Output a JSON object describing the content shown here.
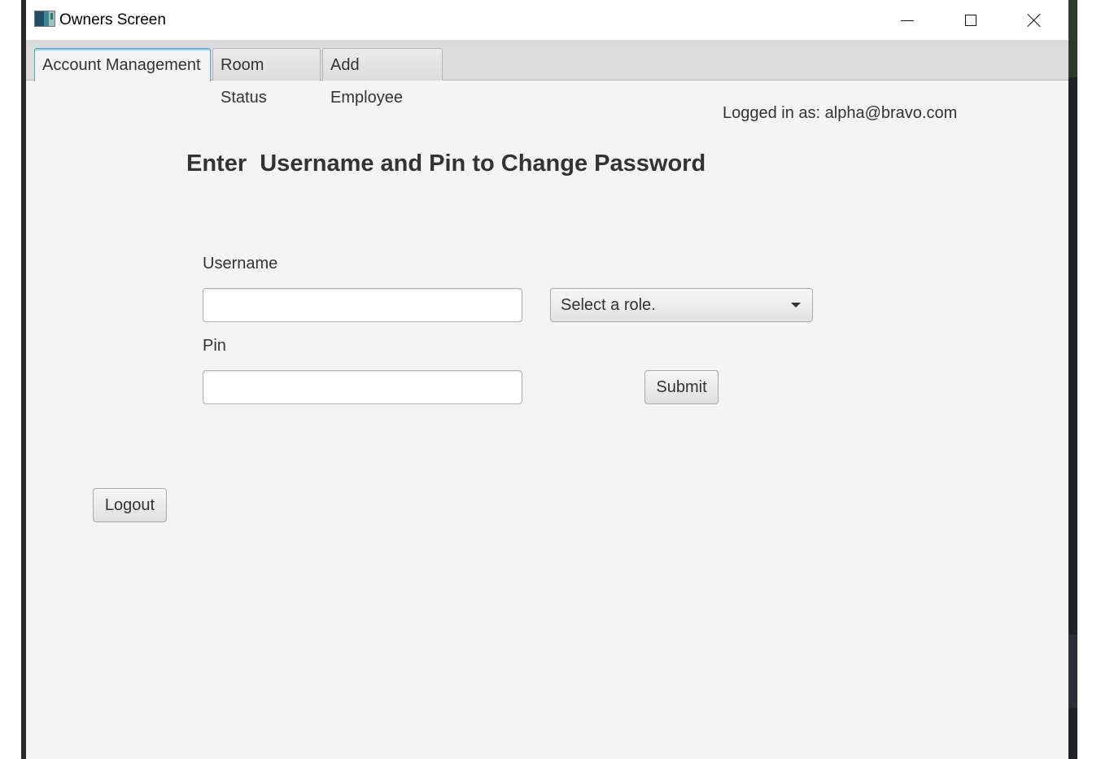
{
  "window": {
    "title": "Owners Screen",
    "controls": {
      "minimize": "minimize-icon",
      "maximize": "maximize-icon",
      "close": "close-icon"
    }
  },
  "tabs": [
    {
      "label": "Account Management",
      "active": true
    },
    {
      "label": "Room Status",
      "active": false
    },
    {
      "label": "Add Employee",
      "active": false
    }
  ],
  "account": {
    "logged_in": "Logged in as: alpha@bravo.com",
    "heading": "Enter  Username and Pin to Change Password",
    "username_label": "Username",
    "username_value": "",
    "pin_label": "Pin",
    "pin_value": "",
    "role_select": {
      "selected": "Select a role."
    },
    "submit_label": "Submit",
    "logout_label": "Logout"
  },
  "colors": {
    "tab_active_border": "#58a6cf",
    "background": "#f4f4f4",
    "text": "#333333"
  }
}
